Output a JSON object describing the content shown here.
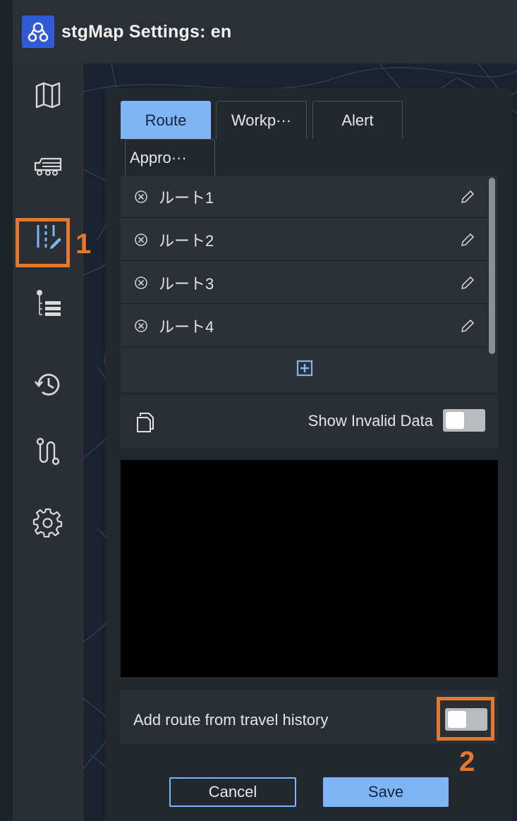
{
  "window": {
    "title": "stgMap Settings: en",
    "logo_icon": "route-pin-logo-icon"
  },
  "sidebar": {
    "items": [
      {
        "icon": "map-icon"
      },
      {
        "icon": "truck-icon"
      },
      {
        "icon": "route-edit-icon",
        "selected": true
      },
      {
        "icon": "timeline-list-icon"
      },
      {
        "icon": "history-icon"
      },
      {
        "icon": "path-icon"
      },
      {
        "icon": "gear-icon"
      }
    ]
  },
  "annotations": {
    "callout_1": "1",
    "callout_2": "2",
    "highlight_color": "#e8772e"
  },
  "tabs": [
    {
      "label": "Route",
      "active": true
    },
    {
      "label": "Workp···",
      "active": false
    },
    {
      "label": "Alert",
      "active": false
    },
    {
      "label": "Appro···",
      "active": false
    }
  ],
  "routes": [
    {
      "label": "ルート1"
    },
    {
      "label": "ルート2"
    },
    {
      "label": "ルート3"
    },
    {
      "label": "ルート4"
    }
  ],
  "invalid_data": {
    "label": "Show Invalid Data",
    "enabled": false
  },
  "travel_history": {
    "label": "Add route from travel history",
    "enabled": false
  },
  "footer": {
    "cancel_label": "Cancel",
    "save_label": "Save"
  },
  "colors": {
    "accent": "#7fb4f5",
    "logo_bg": "#2f5bd8",
    "icon_selected": "#7fb4f5"
  }
}
